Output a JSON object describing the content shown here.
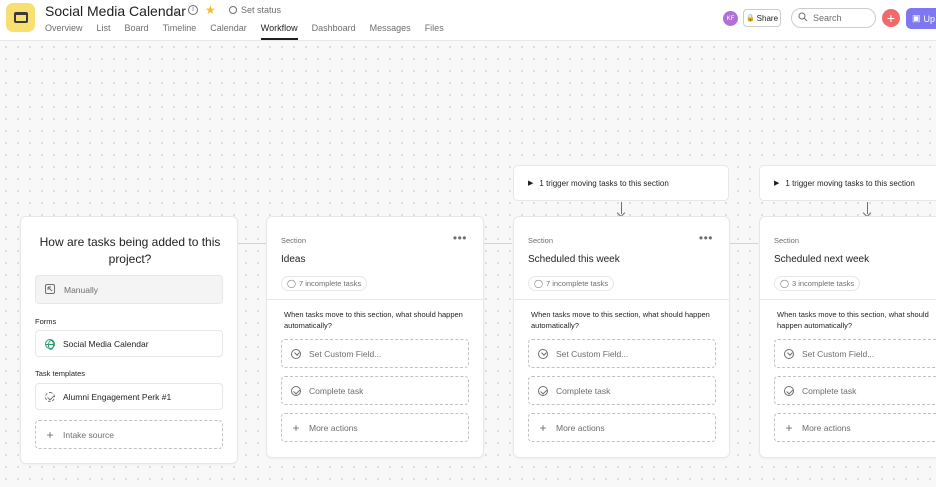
{
  "header": {
    "project_title": "Social Media Calendar",
    "set_status": "Set status",
    "tabs": [
      "Overview",
      "List",
      "Board",
      "Timeline",
      "Calendar",
      "Workflow",
      "Dashboard",
      "Messages",
      "Files"
    ],
    "active_tab": "Workflow",
    "avatar_initials": "KF",
    "share_label": "Share",
    "search_placeholder": "Search",
    "upgrade_label": "Up"
  },
  "intake": {
    "question": "How are tasks being added to this project?",
    "manual_label": "Manually",
    "forms_label": "Forms",
    "form_name": "Social Media Calendar",
    "templates_label": "Task templates",
    "template_name": "Alumni Engagement Perk #1",
    "add_source_label": "Intake source"
  },
  "sections": [
    {
      "label": "Section",
      "name": "Ideas",
      "incomplete": "7 incomplete tasks",
      "trigger": null,
      "question": "When tasks move to this section, what should happen automatically?",
      "actions": [
        "Set Custom Field...",
        "Complete task",
        "More actions"
      ]
    },
    {
      "label": "Section",
      "name": "Scheduled this week",
      "incomplete": "7 incomplete tasks",
      "trigger": "1 trigger moving tasks to this section",
      "question": "When tasks move to this section, what should happen automatically?",
      "actions": [
        "Set Custom Field...",
        "Complete task",
        "More actions"
      ]
    },
    {
      "label": "Section",
      "name": "Scheduled next week",
      "incomplete": "3 incomplete tasks",
      "trigger": "1 trigger moving tasks to this section",
      "question": "When tasks move to this section, what should happen automatically?",
      "actions": [
        "Set Custom Field...",
        "Complete task",
        "More actions"
      ]
    }
  ],
  "colors": {
    "accent_red": "#f06a6a",
    "upgrade_purple": "#7f77f1",
    "avatar_purple": "#b070d6",
    "project_icon_yellow": "#f8df72"
  }
}
